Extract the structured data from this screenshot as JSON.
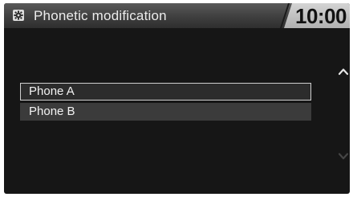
{
  "header": {
    "title": "Phonetic modification",
    "time": "10:00",
    "icon": "settings-icon"
  },
  "list": {
    "items": [
      {
        "label": "Phone A",
        "selected": true
      },
      {
        "label": "Phone B",
        "selected": false
      }
    ]
  },
  "scroll": {
    "up_icon": "chevron-up-icon",
    "down_icon": "chevron-down-icon"
  },
  "colors": {
    "background": "#161616",
    "header_dark": "#3f3f3f",
    "header_light": "#c4c4c4",
    "item_background": "#3b3b3b",
    "selection_border": "#cfcfcf",
    "text": "#f2f2f2"
  }
}
